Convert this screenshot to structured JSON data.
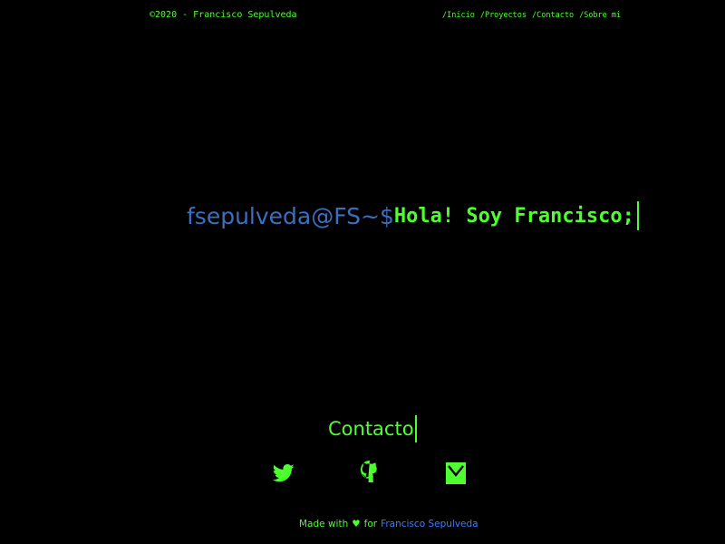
{
  "header": {
    "copyright": "©2020 - Francisco Sepulveda",
    "nav": [
      {
        "label": "/Inicio"
      },
      {
        "label": "/Proyectos"
      },
      {
        "label": "/Contacto"
      },
      {
        "label": "/Sobre mi"
      }
    ]
  },
  "hero": {
    "prompt": "fsepulveda@FS~$",
    "greeting": "Hola! Soy Francisco;"
  },
  "contact": {
    "heading": "Contacto",
    "icons": [
      "twitter-icon",
      "github-icon",
      "email-icon"
    ]
  },
  "footer": {
    "made_with": "Made with",
    "heart": "♥",
    "for": "for",
    "author": "Francisco Sepulveda"
  },
  "colors": {
    "background": "#000000",
    "terminal_green": "#4dff2e",
    "prompt_blue": "#3b6fbf",
    "link_blue": "#3b7dff"
  }
}
